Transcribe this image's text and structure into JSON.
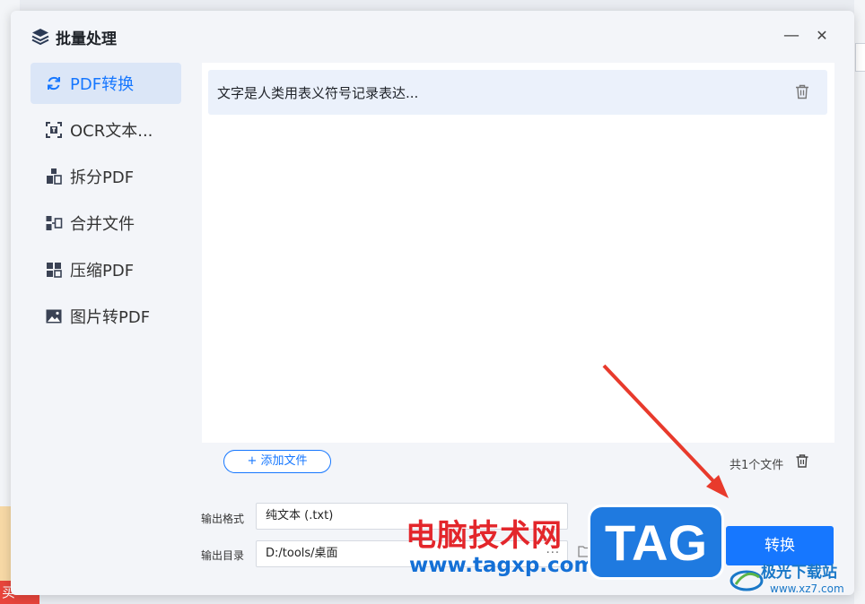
{
  "dialog": {
    "title": "批量处理",
    "minimize_glyph": "—",
    "close_glyph": "✕"
  },
  "sidebar": {
    "items": [
      {
        "label": "PDF转换",
        "icon": "refresh-icon",
        "active": true
      },
      {
        "label": "OCR文本...",
        "icon": "ocr-text-icon",
        "active": false
      },
      {
        "label": "拆分PDF",
        "icon": "split-icon",
        "active": false
      },
      {
        "label": "合并文件",
        "icon": "merge-icon",
        "active": false
      },
      {
        "label": "压缩PDF",
        "icon": "compress-icon",
        "active": false
      },
      {
        "label": "图片转PDF",
        "icon": "image-icon",
        "active": false
      }
    ]
  },
  "files": {
    "items": [
      {
        "name": "文字是人类用表义符号记录表达..."
      }
    ],
    "add_label": "+ 添加文件",
    "count_label": "共1个文件"
  },
  "options": {
    "format_label": "输出格式",
    "format_value": "纯文本 (.txt)",
    "dir_label": "输出目录",
    "dir_value": "D:/tools/桌面",
    "dots": "···"
  },
  "convert_label": "转换",
  "watermark": {
    "site_cn": "电脑技术网",
    "site_url": "www.tagxp.com",
    "tag": "TAG",
    "logo_text": "极光下载站",
    "logo_url": "www.xz7.com"
  },
  "background": {
    "left_fragment": "买"
  },
  "colors": {
    "accent": "#1677ff",
    "active_bg": "#dbe6f7",
    "arrow": "#e83a2c"
  }
}
